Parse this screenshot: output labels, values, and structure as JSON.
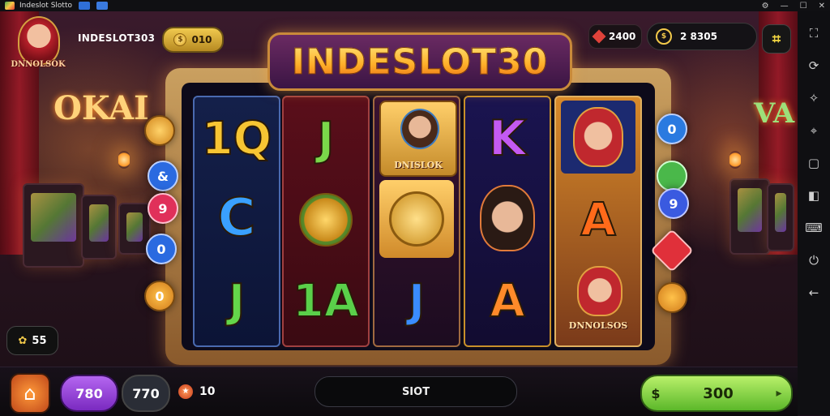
{
  "window": {
    "title": "Indeslot Slotto",
    "controls": [
      "⚙",
      "—",
      "☐",
      "✕"
    ]
  },
  "header": {
    "avatar_banner": "DNNOLSOK",
    "player_name": "INDESLOT303",
    "player_pill_value": "010",
    "gems_value": "2400",
    "coins_value": "2 8305",
    "menu_icon": "grid-icon"
  },
  "game_title": "INDESLOT30",
  "reels": [
    {
      "symbols": [
        "1Q",
        "C",
        "J"
      ]
    },
    {
      "symbols": [
        "J",
        "emblem",
        "1A"
      ]
    },
    {
      "symbols": [
        "DNISLOK",
        "coin",
        "J"
      ]
    },
    {
      "symbols": [
        "K",
        "portrait",
        "A"
      ]
    },
    {
      "symbols": [
        "portrait",
        "A",
        "DNNOLSOS"
      ]
    }
  ],
  "left_chips": [
    "",
    "&",
    "9",
    "0",
    "0"
  ],
  "right_chips": [
    "0",
    "",
    "9",
    "",
    ""
  ],
  "wallet": {
    "value": "55"
  },
  "footer": {
    "bet_value": "780",
    "lines_value": "770",
    "level_value": "10",
    "spin_label": "SIOT",
    "win_value": "300"
  },
  "colors": {
    "frame_gold": "#caa060",
    "title_gold": "#ffb02a",
    "bet_purple": "#9a45d8",
    "win_green": "#8ad84a"
  }
}
